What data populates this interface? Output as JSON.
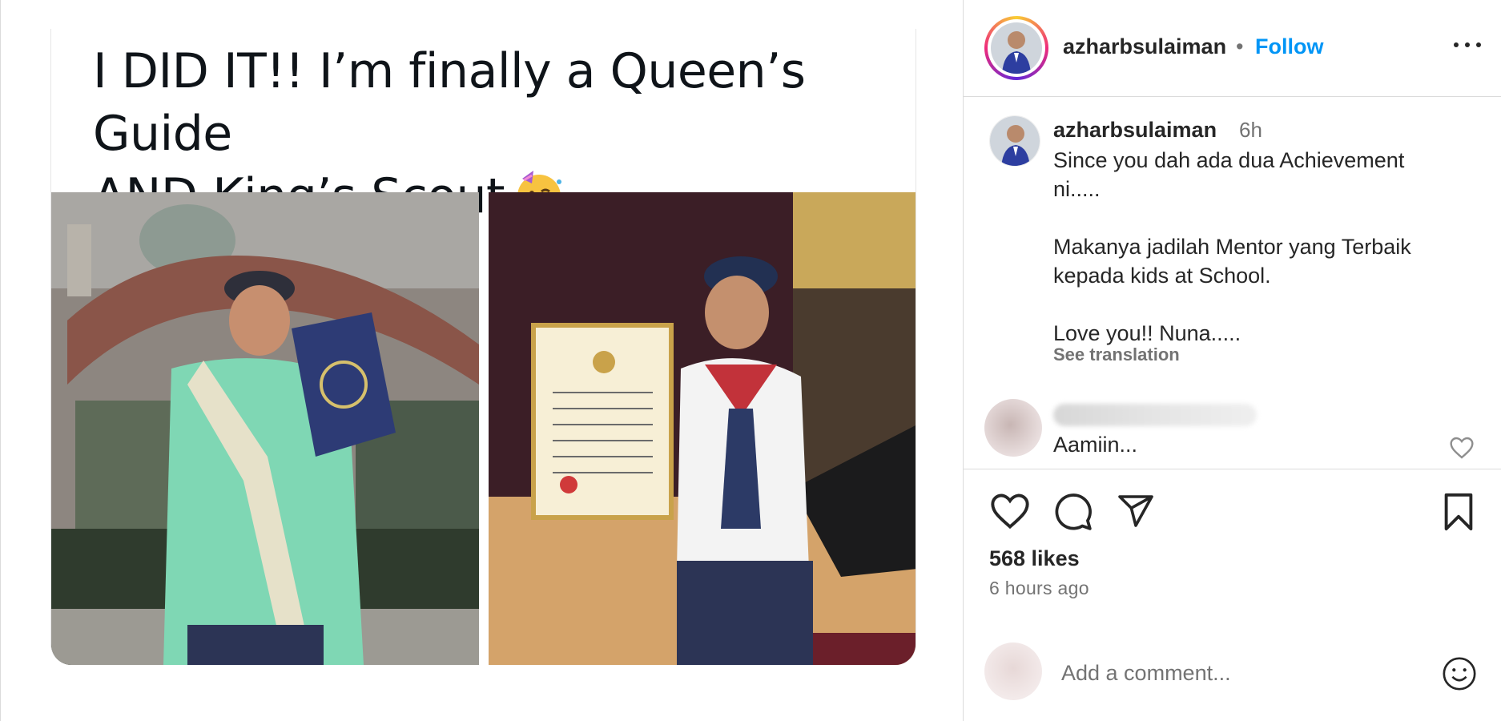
{
  "tweet": {
    "line1": "I DID IT!! I’m finally a Queen’s Guide",
    "line2": "AND King’s Scout"
  },
  "header": {
    "username": "azharbsulaiman",
    "separator": "•",
    "follow_label": "Follow"
  },
  "caption": {
    "username": "azharbsulaiman",
    "time": "6h",
    "lines": [
      "Since you dah ada dua Achievement",
      "ni.....",
      "",
      "Makanya jadilah Mentor yang Terbaik",
      "kepada kids at School.",
      "",
      "Love you!! Nuna....."
    ],
    "see_translation": "See translation"
  },
  "comment": {
    "text": "Aamiin..."
  },
  "stats": {
    "likes": "568 likes",
    "time_ago": "6 hours ago"
  },
  "add_comment": {
    "placeholder": "Add a comment..."
  },
  "icons": {
    "like": "heart-icon",
    "comment": "comment-bubble-icon",
    "share": "paper-plane-icon",
    "save": "bookmark-icon",
    "more": "more-horizontal-icon",
    "emoji": "smiley-icon",
    "tweet_emoji": "partying-face-emoji"
  },
  "colors": {
    "accent": "#0095f6",
    "text": "#262626",
    "secondary": "#737373",
    "border": "#dbdbdb"
  }
}
